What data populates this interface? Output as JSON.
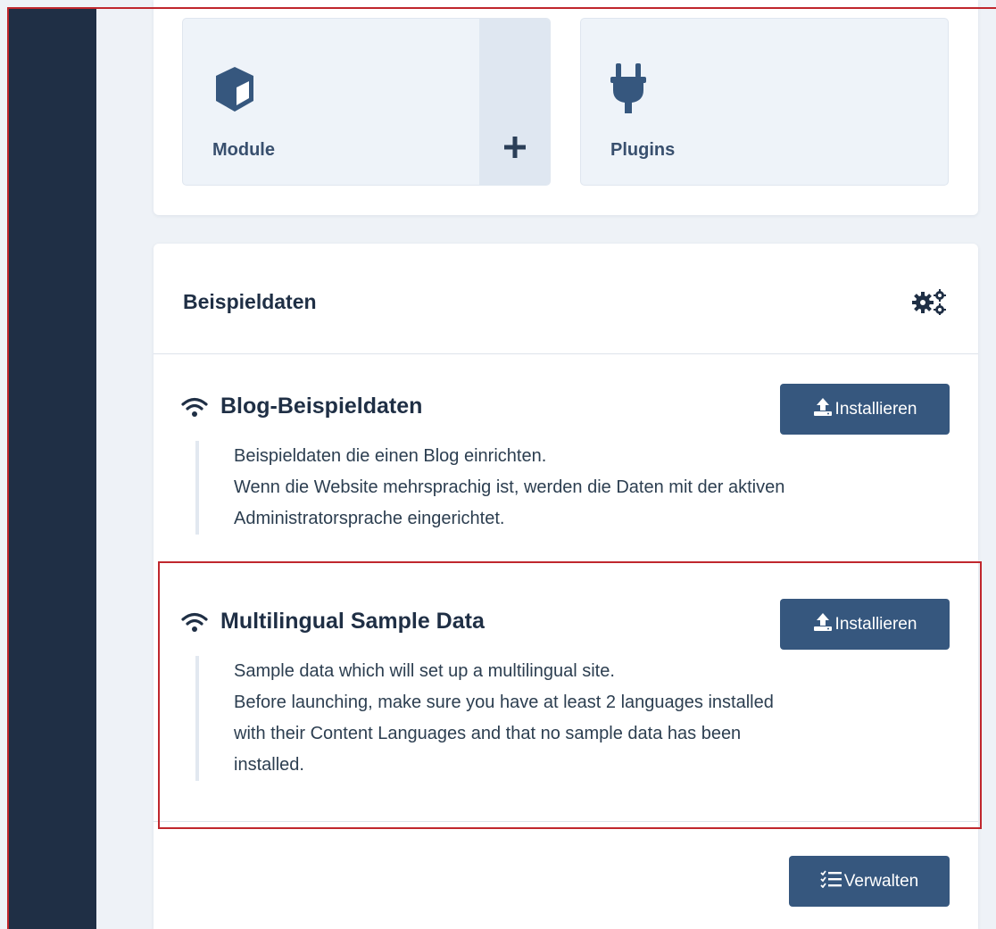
{
  "quick_tiles": {
    "modules": {
      "label": "Module",
      "icon": "cube-icon",
      "add_icon": "plus-icon"
    },
    "plugins": {
      "label": "Plugins",
      "icon": "plug-icon"
    }
  },
  "sample_data": {
    "title": "Beispieldaten",
    "options_icon": "gears-icon",
    "items": [
      {
        "icon": "wifi-icon",
        "title": "Blog-Beispieldaten",
        "button": "Installieren",
        "desc_lines": [
          "Beispieldaten die einen Blog einrichten.",
          "Wenn die Website mehrsprachig ist, werden die Daten mit der aktiven",
          "Administratorsprache eingerichtet."
        ]
      },
      {
        "icon": "wifi-icon",
        "title": "Multilingual Sample Data",
        "button": "Installieren",
        "desc_lines": [
          "Sample data which will set up a multilingual site.",
          "Before launching, make sure you have at least 2 languages installed",
          "with their Content Languages and that no sample data has been",
          "installed."
        ]
      }
    ],
    "manage_button": "Verwalten"
  },
  "colors": {
    "sidebar": "#1f2f45",
    "button": "#36577e",
    "highlight": "#c0272d",
    "tile_bg": "#eef3f9"
  }
}
